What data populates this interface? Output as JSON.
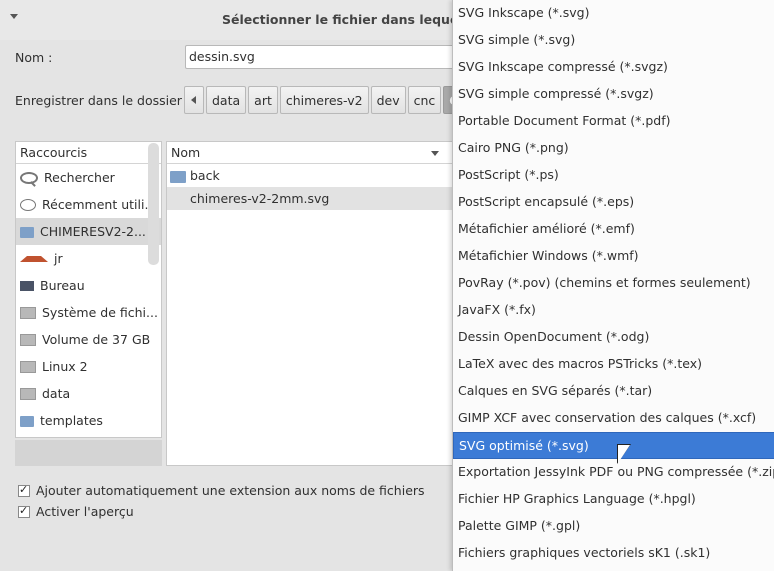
{
  "dialog": {
    "title": "Sélectionner le fichier dans lequel enre",
    "name_label": "Nom :",
    "name_value": "dessin.svg",
    "save_in_label": "Enregistrer dans le dossier :"
  },
  "pathbar": [
    "data",
    "art",
    "chimeres-v2",
    "dev",
    "cnc",
    "CHIM"
  ],
  "places": {
    "header": "Raccourcis",
    "items": [
      {
        "label": "Rechercher",
        "icon": "search-icon"
      },
      {
        "label": "Récemment utili...",
        "icon": "clock-icon"
      },
      {
        "label": "CHIMERESV2-2...",
        "icon": "folder-icon"
      },
      {
        "label": "jr",
        "icon": "home-icon"
      },
      {
        "label": "Bureau",
        "icon": "desktop-icon"
      },
      {
        "label": "Système de fichi...",
        "icon": "drive-icon"
      },
      {
        "label": "Volume de 37 GB",
        "icon": "drive-icon"
      },
      {
        "label": "Linux 2",
        "icon": "drive-icon"
      },
      {
        "label": "data",
        "icon": "drive-icon"
      },
      {
        "label": "templates",
        "icon": "folder-icon"
      }
    ]
  },
  "files": {
    "header": "Nom",
    "rows": [
      {
        "name": "back",
        "icon": "folder-icon"
      },
      {
        "name": "chimeres-v2-2mm.svg",
        "icon": "file-icon"
      }
    ]
  },
  "options": {
    "auto_extension": "Ajouter automatiquement une extension aux noms de fichiers",
    "preview": "Activer l'aperçu"
  },
  "menu": {
    "selected_index": 16,
    "items": [
      "SVG Inkscape (*.svg)",
      "SVG simple (*.svg)",
      "SVG Inkscape compressé (*.svgz)",
      "SVG simple compressé (*.svgz)",
      "Portable Document Format (*.pdf)",
      "Cairo PNG (*.png)",
      "PostScript (*.ps)",
      "PostScript encapsulé (*.eps)",
      "Métafichier amélioré (*.emf)",
      "Métafichier Windows (*.wmf)",
      "PovRay (*.pov) (chemins et formes seulement)",
      "JavaFX (*.fx)",
      "Dessin OpenDocument (*.odg)",
      "LaTeX avec des macros PSTricks (*.tex)",
      "Calques en SVG séparés (*.tar)",
      "GIMP XCF avec conservation des calques (*.xcf)",
      "SVG optimisé (*.svg)",
      "Exportation JessyInk PDF ou PNG compressée (*.zip)",
      "Fichier HP Graphics Language (*.hpgl)",
      "Palette GIMP (*.gpl)",
      "Fichiers graphiques vectoriels sK1 (.sk1)"
    ]
  }
}
